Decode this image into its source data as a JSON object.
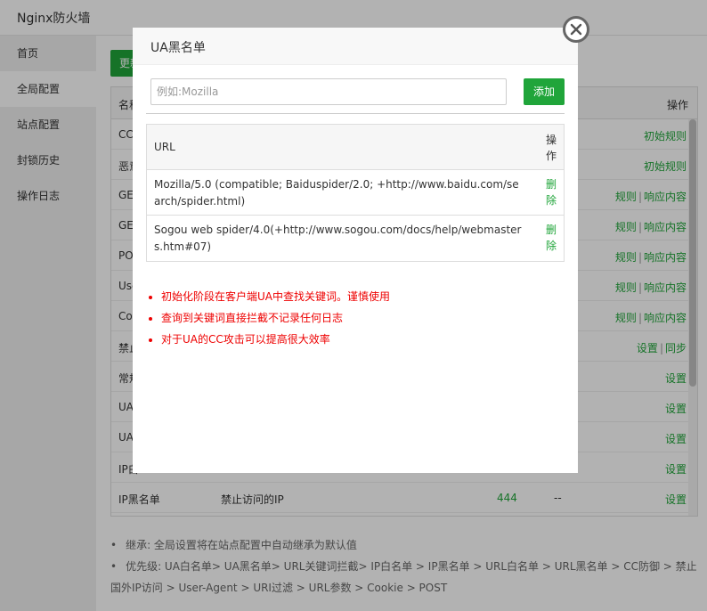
{
  "app": {
    "title": "Nginx防火墙"
  },
  "sidebar": {
    "items": [
      {
        "label": "首页"
      },
      {
        "label": "全局配置"
      },
      {
        "label": "站点配置"
      },
      {
        "label": "封锁历史"
      },
      {
        "label": "操作日志"
      }
    ]
  },
  "main": {
    "update_button": "更新",
    "table_head": {
      "name": "名称",
      "op": "操作"
    },
    "rows": [
      {
        "name": "CC",
        "desc": "",
        "code": "",
        "dash": "",
        "ops": [
          "初始规则"
        ]
      },
      {
        "name": "恶意",
        "desc": "",
        "code": "",
        "dash": "",
        "ops": [
          "初始规则"
        ]
      },
      {
        "name": "GET",
        "desc": "",
        "code": "",
        "dash": "",
        "ops": [
          "规则",
          "响应内容"
        ]
      },
      {
        "name": "GET",
        "desc": "",
        "code": "",
        "dash": "",
        "ops": [
          "规则",
          "响应内容"
        ]
      },
      {
        "name": "POS",
        "desc": "",
        "code": "",
        "dash": "",
        "ops": [
          "规则",
          "响应内容"
        ]
      },
      {
        "name": "Use",
        "desc": "",
        "code": "",
        "dash": "",
        "ops": [
          "规则",
          "响应内容"
        ]
      },
      {
        "name": "Coo",
        "desc": "",
        "code": "",
        "dash": "",
        "ops": [
          "规则",
          "响应内容"
        ]
      },
      {
        "name": "禁止",
        "desc": "",
        "code": "",
        "dash": "",
        "ops": [
          "设置",
          "同步"
        ]
      },
      {
        "name": "常规",
        "desc": "",
        "code": "",
        "dash": "",
        "ops": [
          "设置"
        ]
      },
      {
        "name": "UA",
        "desc": "",
        "code": "",
        "dash": "",
        "ops": [
          "设置"
        ]
      },
      {
        "name": "UA",
        "desc": "",
        "code": "",
        "dash": "",
        "ops": [
          "设置"
        ]
      },
      {
        "name": "IP白",
        "desc": "",
        "code": "",
        "dash": "",
        "ops": [
          "设置"
        ]
      },
      {
        "name": "IP黑名单",
        "desc": "禁止访问的IP",
        "code": "444",
        "dash": "--",
        "ops": [
          "设置"
        ]
      }
    ],
    "notes": [
      "继承: 全局设置将在站点配置中自动继承为默认值",
      "优先级: UA白名单> UA黑名单> URL关键词拦截> IP白名单 > IP黑名单 > URL白名单 > URL黑名单 > CC防御 > 禁止国外IP访问 > User-Agent > URI过滤 > URL参数 > Cookie > POST"
    ]
  },
  "modal": {
    "title": "UA黑名单",
    "input": {
      "placeholder": "例如:Mozilla",
      "value": ""
    },
    "add_button": "添加",
    "table_head": {
      "url": "URL",
      "op": "操作"
    },
    "rows": [
      {
        "url": "Mozilla/5.0 (compatible; Baiduspider/2.0; +http://www.baidu.com/search/spider.html)",
        "del": "删除"
      },
      {
        "url": "Sogou web spider/4.0(+http://www.sogou.com/docs/help/webmasters.htm#07)",
        "del": "删除"
      }
    ],
    "tips": [
      "初始化阶段在客户端UA中查找关键词。谨慎使用",
      "查询到关键词直接拦截不记录任何日志",
      "对于UA的CC攻击可以提高很大效率"
    ]
  },
  "colors": {
    "accent": "#20a53a",
    "warning": "#e00000"
  }
}
